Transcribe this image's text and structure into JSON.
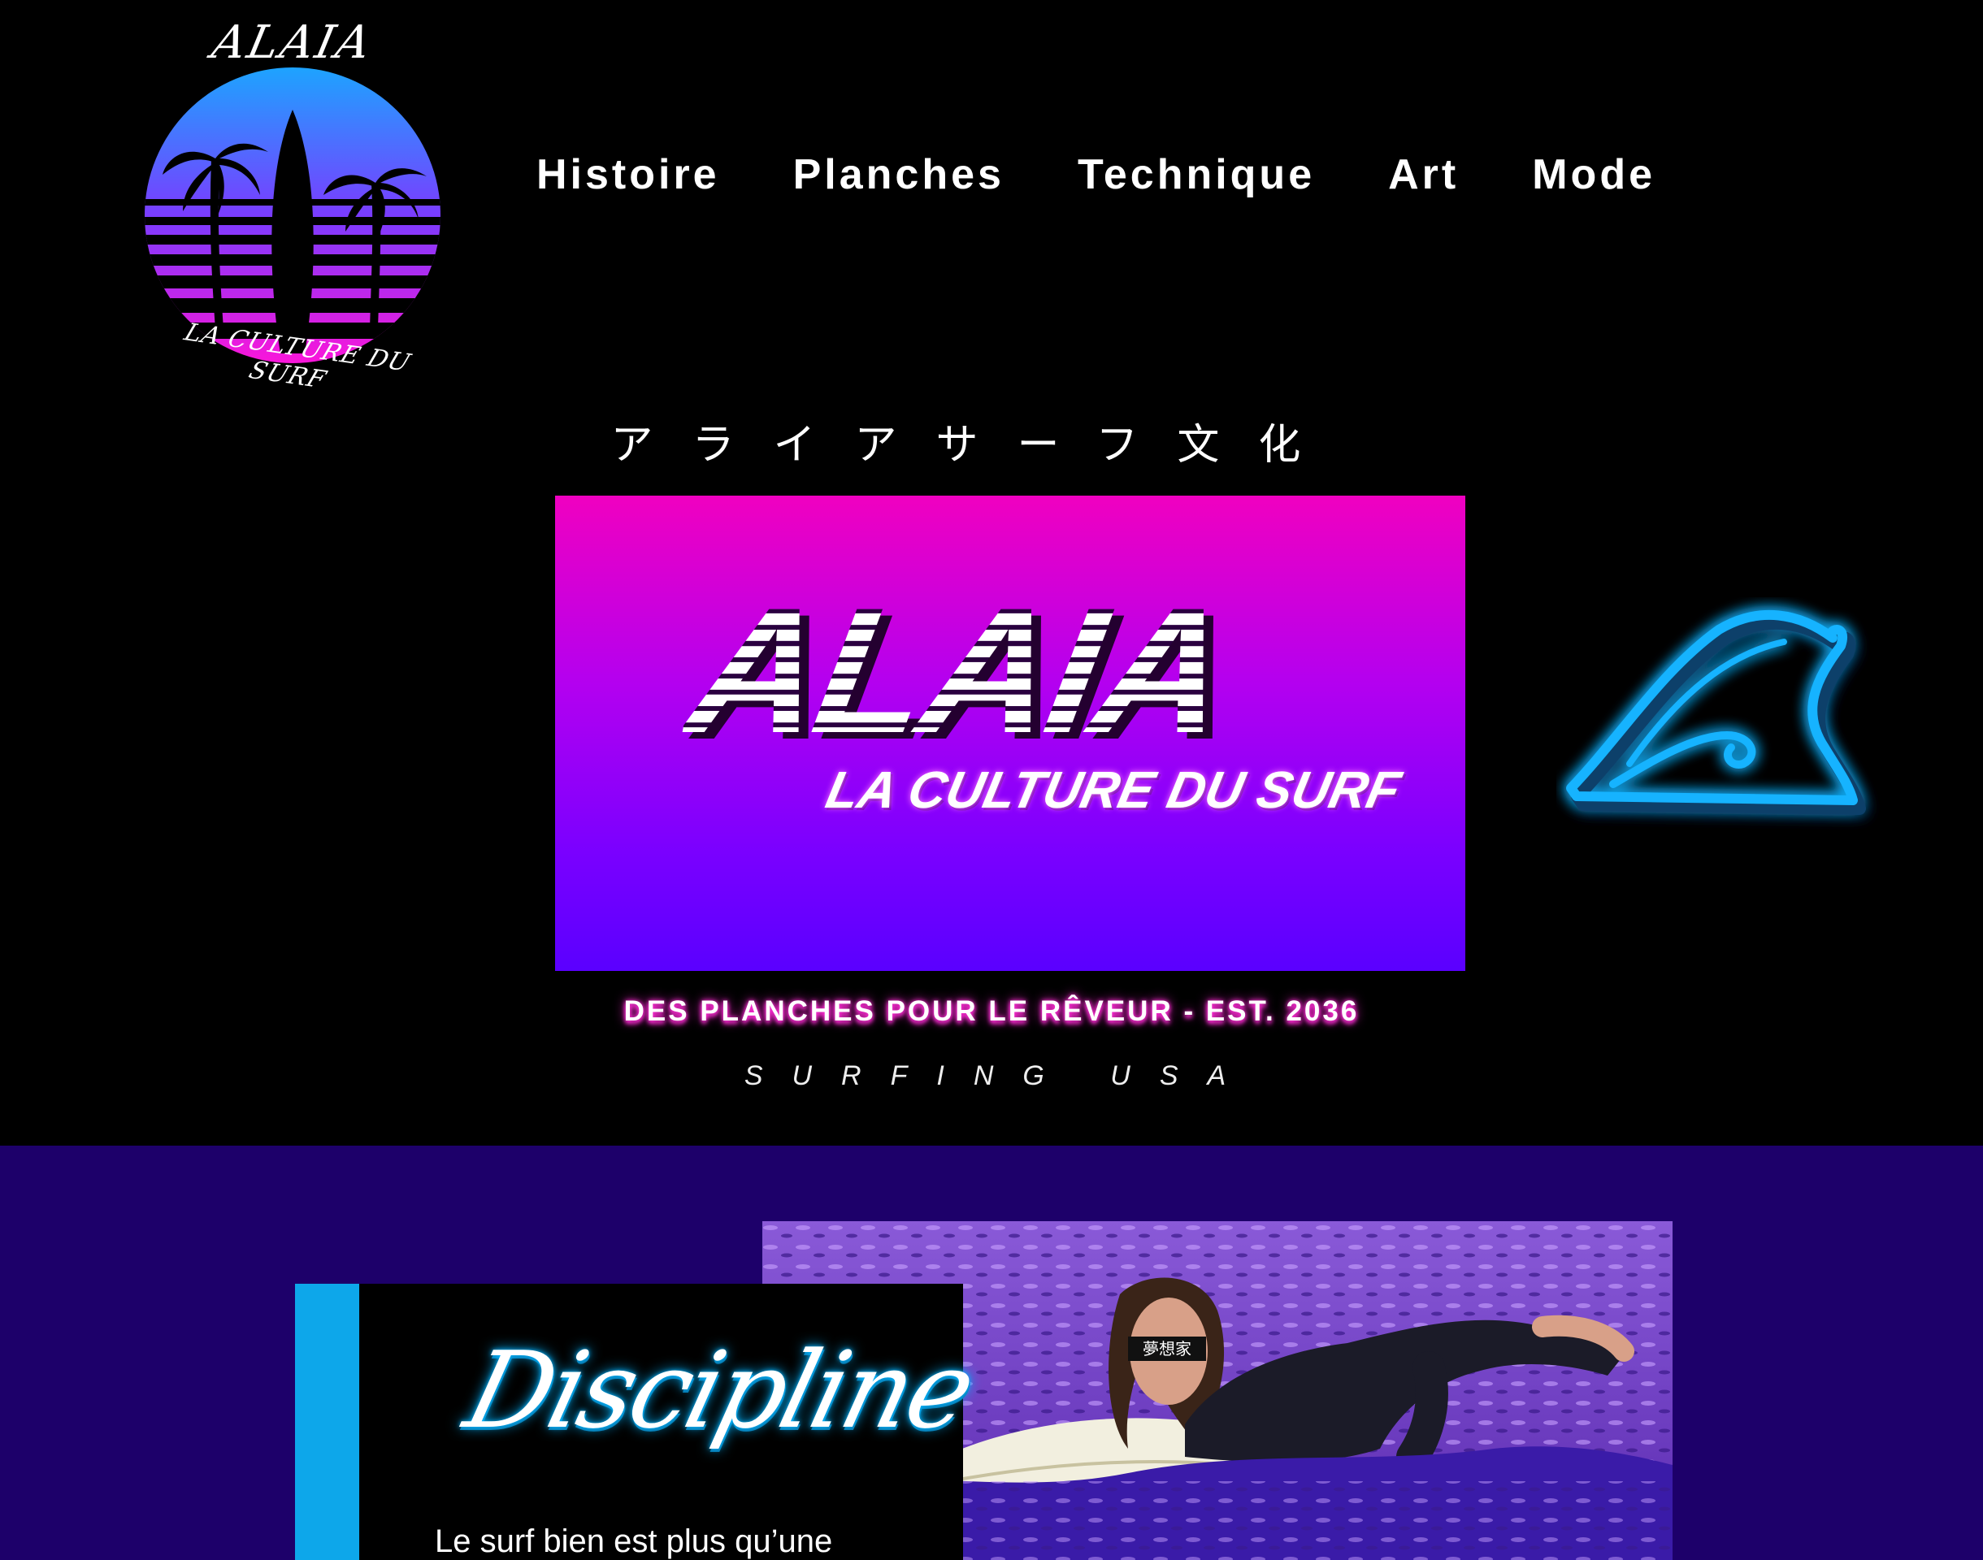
{
  "logo": {
    "wordmark_top": "ALAIA",
    "wordmark_bottom": "LA CULTURE DU SURF",
    "icon": "sunset-palm-surfboard-icon"
  },
  "nav": {
    "items": [
      "Histoire",
      "Planches",
      "Technique",
      "Art",
      "Mode"
    ]
  },
  "hero": {
    "japanese_title": "アライアサーフ文化",
    "banner_title": "ALAIA",
    "banner_subtitle": "LA CULTURE DU SURF",
    "wave_icon": "neon-wave-icon",
    "tagline": "DES PLANCHES POUR LE RÊVEUR -  EST. 2036",
    "surfing_usa": "SURFING USA"
  },
  "section": {
    "card_title": "Discipline",
    "card_text": "Le surf bien est plus qu’une",
    "photo_label": "夢想家",
    "photo_alt": "surfer-paddling-image"
  },
  "colors": {
    "background": "#000000",
    "lower_background": "#1d006a",
    "hero_gradient_top": "#f000c0",
    "hero_gradient_bottom": "#5a00ff",
    "accent_blue": "#0da7ea",
    "neon_pink": "#ff2dd5"
  }
}
